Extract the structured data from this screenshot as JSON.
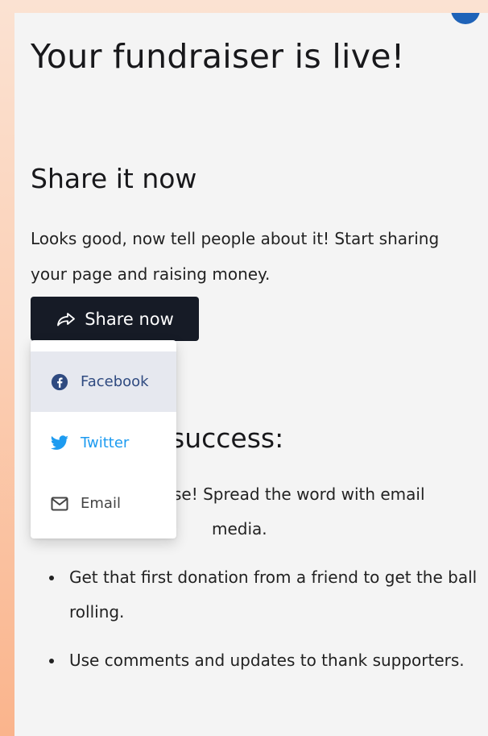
{
  "page": {
    "title": "Your fundraiser is live!"
  },
  "share": {
    "heading": "Share it now",
    "description": "Looks good, now tell people about it! Start sharing your page and raising money.",
    "button_label": "Share now",
    "menu": [
      {
        "label": "Facebook",
        "icon": "facebook-icon"
      },
      {
        "label": "Twitter",
        "icon": "twitter-icon"
      },
      {
        "label": "Email",
        "icon": "email-icon"
      }
    ]
  },
  "tips": {
    "heading_visible": "success:",
    "items": [
      {
        "visible_text": "se! Spread the word with email media."
      },
      {
        "visible_text": "Get that first donation from a friend to get the ball rolling."
      },
      {
        "visible_text": "Use comments and updates to thank supporters."
      }
    ]
  },
  "colors": {
    "button_bg": "#161b26",
    "facebook": "#2f4a80",
    "twitter": "#1d9bf0",
    "card_bg": "#f4f4f4"
  }
}
